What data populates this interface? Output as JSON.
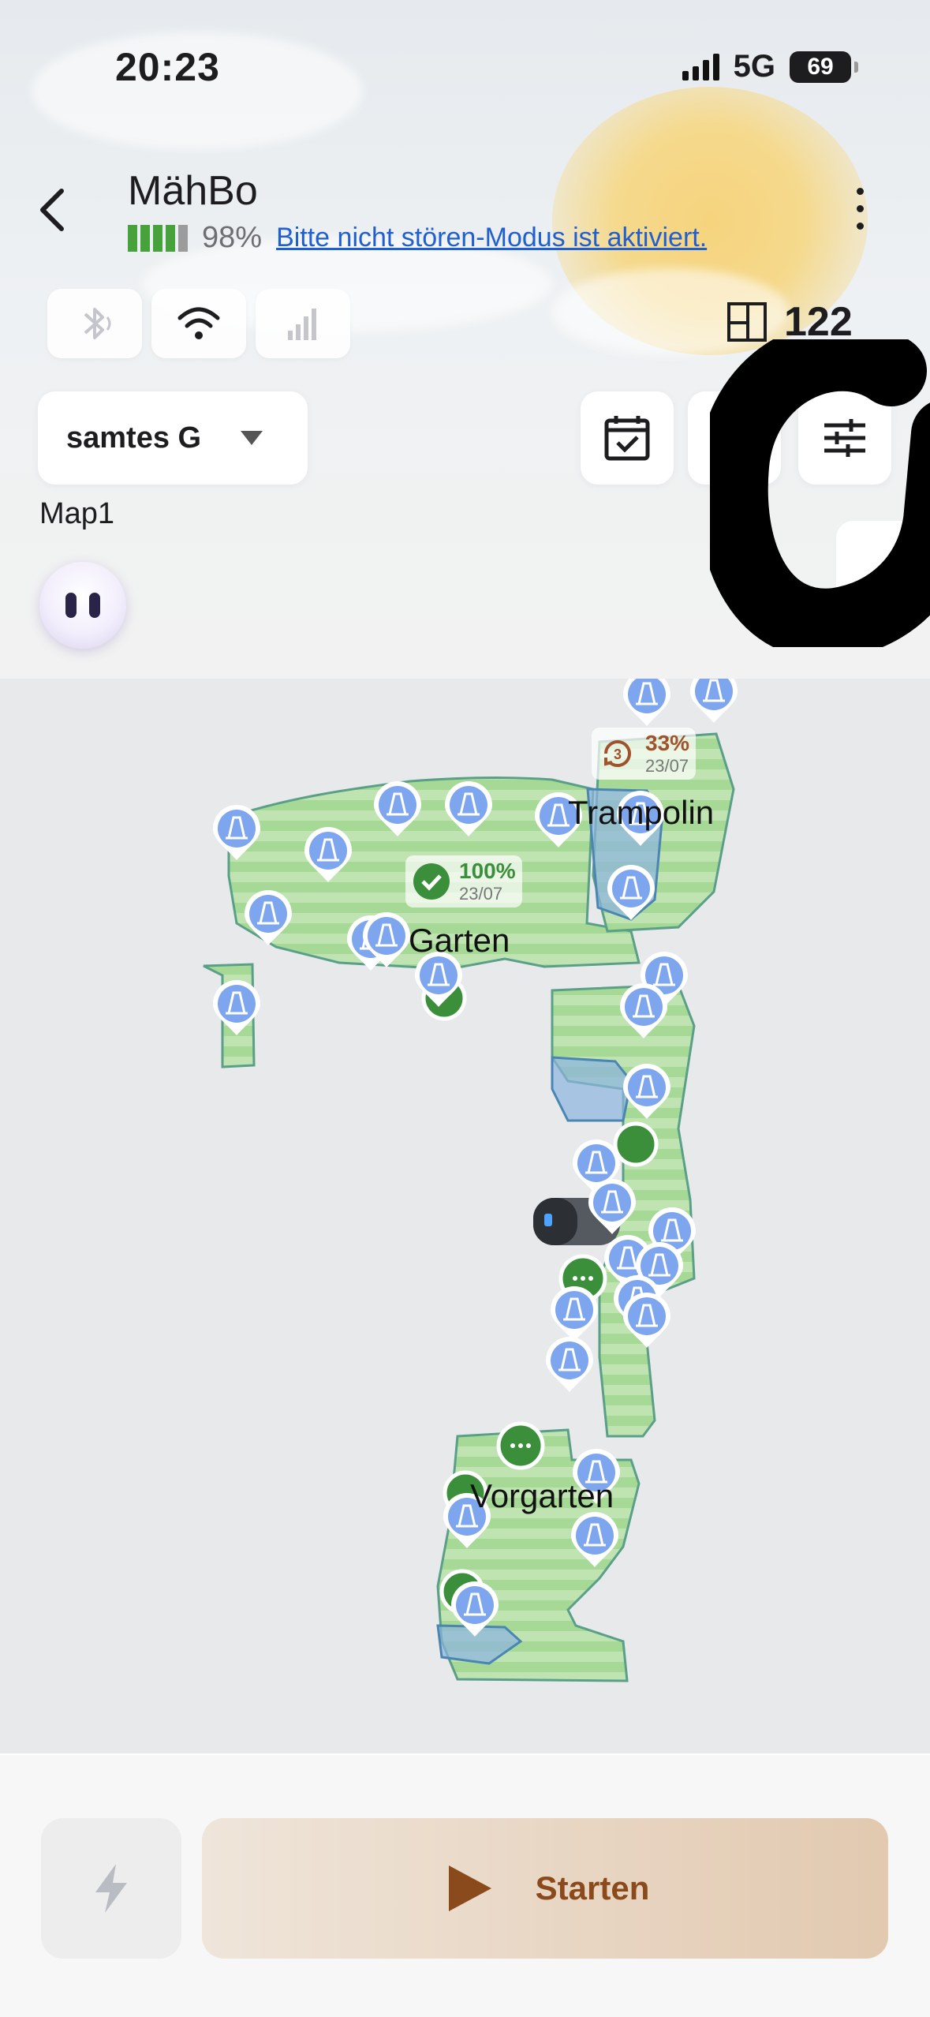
{
  "status_bar": {
    "time": "20:23",
    "network": "5G",
    "battery": "69"
  },
  "header": {
    "title": "MähBo",
    "battery_percent": "98%",
    "battery_bars": 4,
    "dnd_message": "Bitte nicht stören-Modus ist aktiviert."
  },
  "area_info": {
    "value": "122"
  },
  "map_selector": {
    "selected": "samtes G"
  },
  "map_name": "Map1",
  "zones": [
    {
      "name": "Garten",
      "progress": "100%",
      "date": "23/07",
      "status": "done"
    },
    {
      "name": "Trampolin",
      "progress": "33%",
      "date": "23/07",
      "status": "partial",
      "cycle": "3"
    },
    {
      "name": "Vorgarten"
    }
  ],
  "colors": {
    "accent_green": "#47a23b",
    "lawn_green": "#a9d89a",
    "obstacle_blue": "#7ea6ee",
    "partial_brown": "#a0522d",
    "start_text": "#8b4a1b",
    "link_blue": "#1f5fd1"
  },
  "icons": [
    "back-icon",
    "bluetooth-icon",
    "wifi-icon",
    "cellular-icon",
    "area-icon",
    "calendar-icon",
    "route-icon",
    "settings-sliders-icon",
    "charge-icon",
    "play-icon"
  ],
  "actions": {
    "start_label": "Starten"
  }
}
